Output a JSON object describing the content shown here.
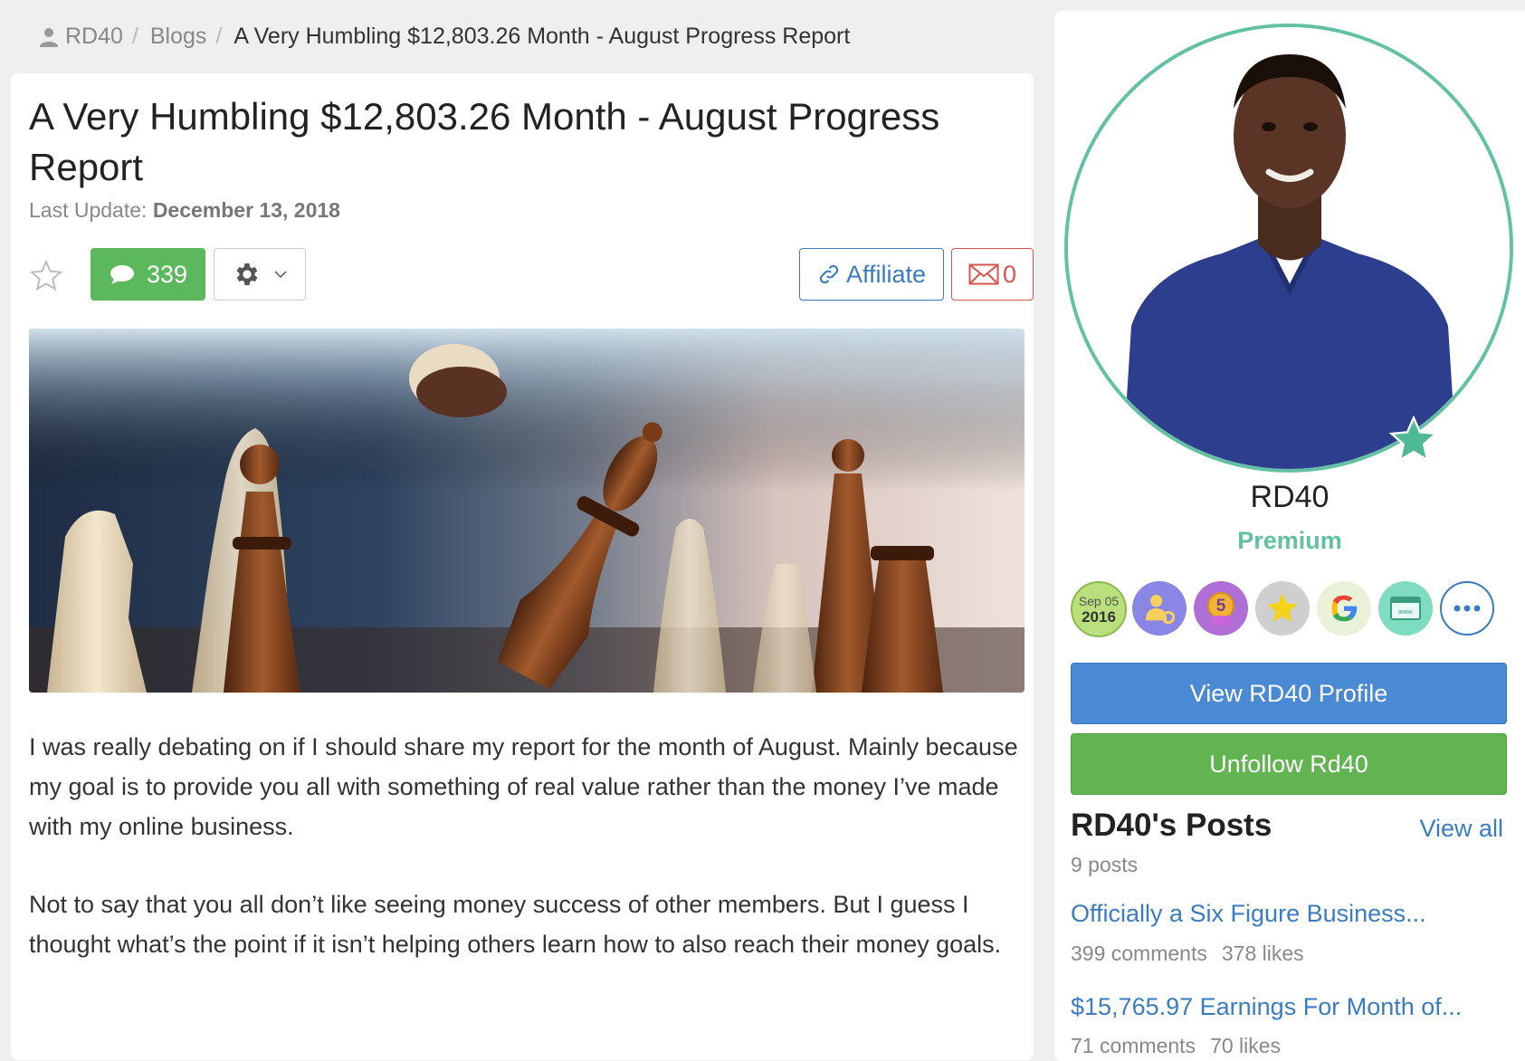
{
  "breadcrumb": {
    "user": "RD40",
    "section": "Blogs",
    "current": "A Very Humbling $12,803.26 Month - August Progress Report",
    "separator": "/"
  },
  "post": {
    "title": "A Very Humbling $12,803.26 Month - August Progress Report",
    "last_update_label": "Last Update:",
    "last_update_date": "December 13, 2018",
    "comment_count": "339",
    "affiliate_label": "Affiliate",
    "mail_count": "0",
    "paragraphs": [
      "I was really debating on if I should share my report for the month of August. Mainly because my goal is to provide you all with something of real value rather than the money I’ve made with my online business.",
      "Not to say that you all don’t like seeing money success of other members. But I guess I thought what’s the point if it isn’t helping others learn how to also reach their money goals."
    ]
  },
  "sidebar": {
    "name": "RD40",
    "level": "Premium",
    "badge_date_month": "Sep 05",
    "badge_date_year": "2016",
    "badge_rank_number": "5",
    "view_profile_label": "View RD40 Profile",
    "unfollow_label": "Unfollow Rd40",
    "posts_title": "RD40's Posts",
    "view_all_label": "View all",
    "posts_count": "9 posts",
    "posts": [
      {
        "title": "Officially a Six Figure Business...",
        "comments": "399 comments",
        "likes": "378 likes"
      },
      {
        "title": "$15,765.97 Earnings For Month of...",
        "comments": "71 comments",
        "likes": "70 likes"
      }
    ]
  },
  "colors": {
    "accent_blue": "#3a7cc2",
    "green": "#5cb85c",
    "teal": "#62c1a2",
    "red": "#d9534f",
    "profile_button": "#4a89d3"
  }
}
